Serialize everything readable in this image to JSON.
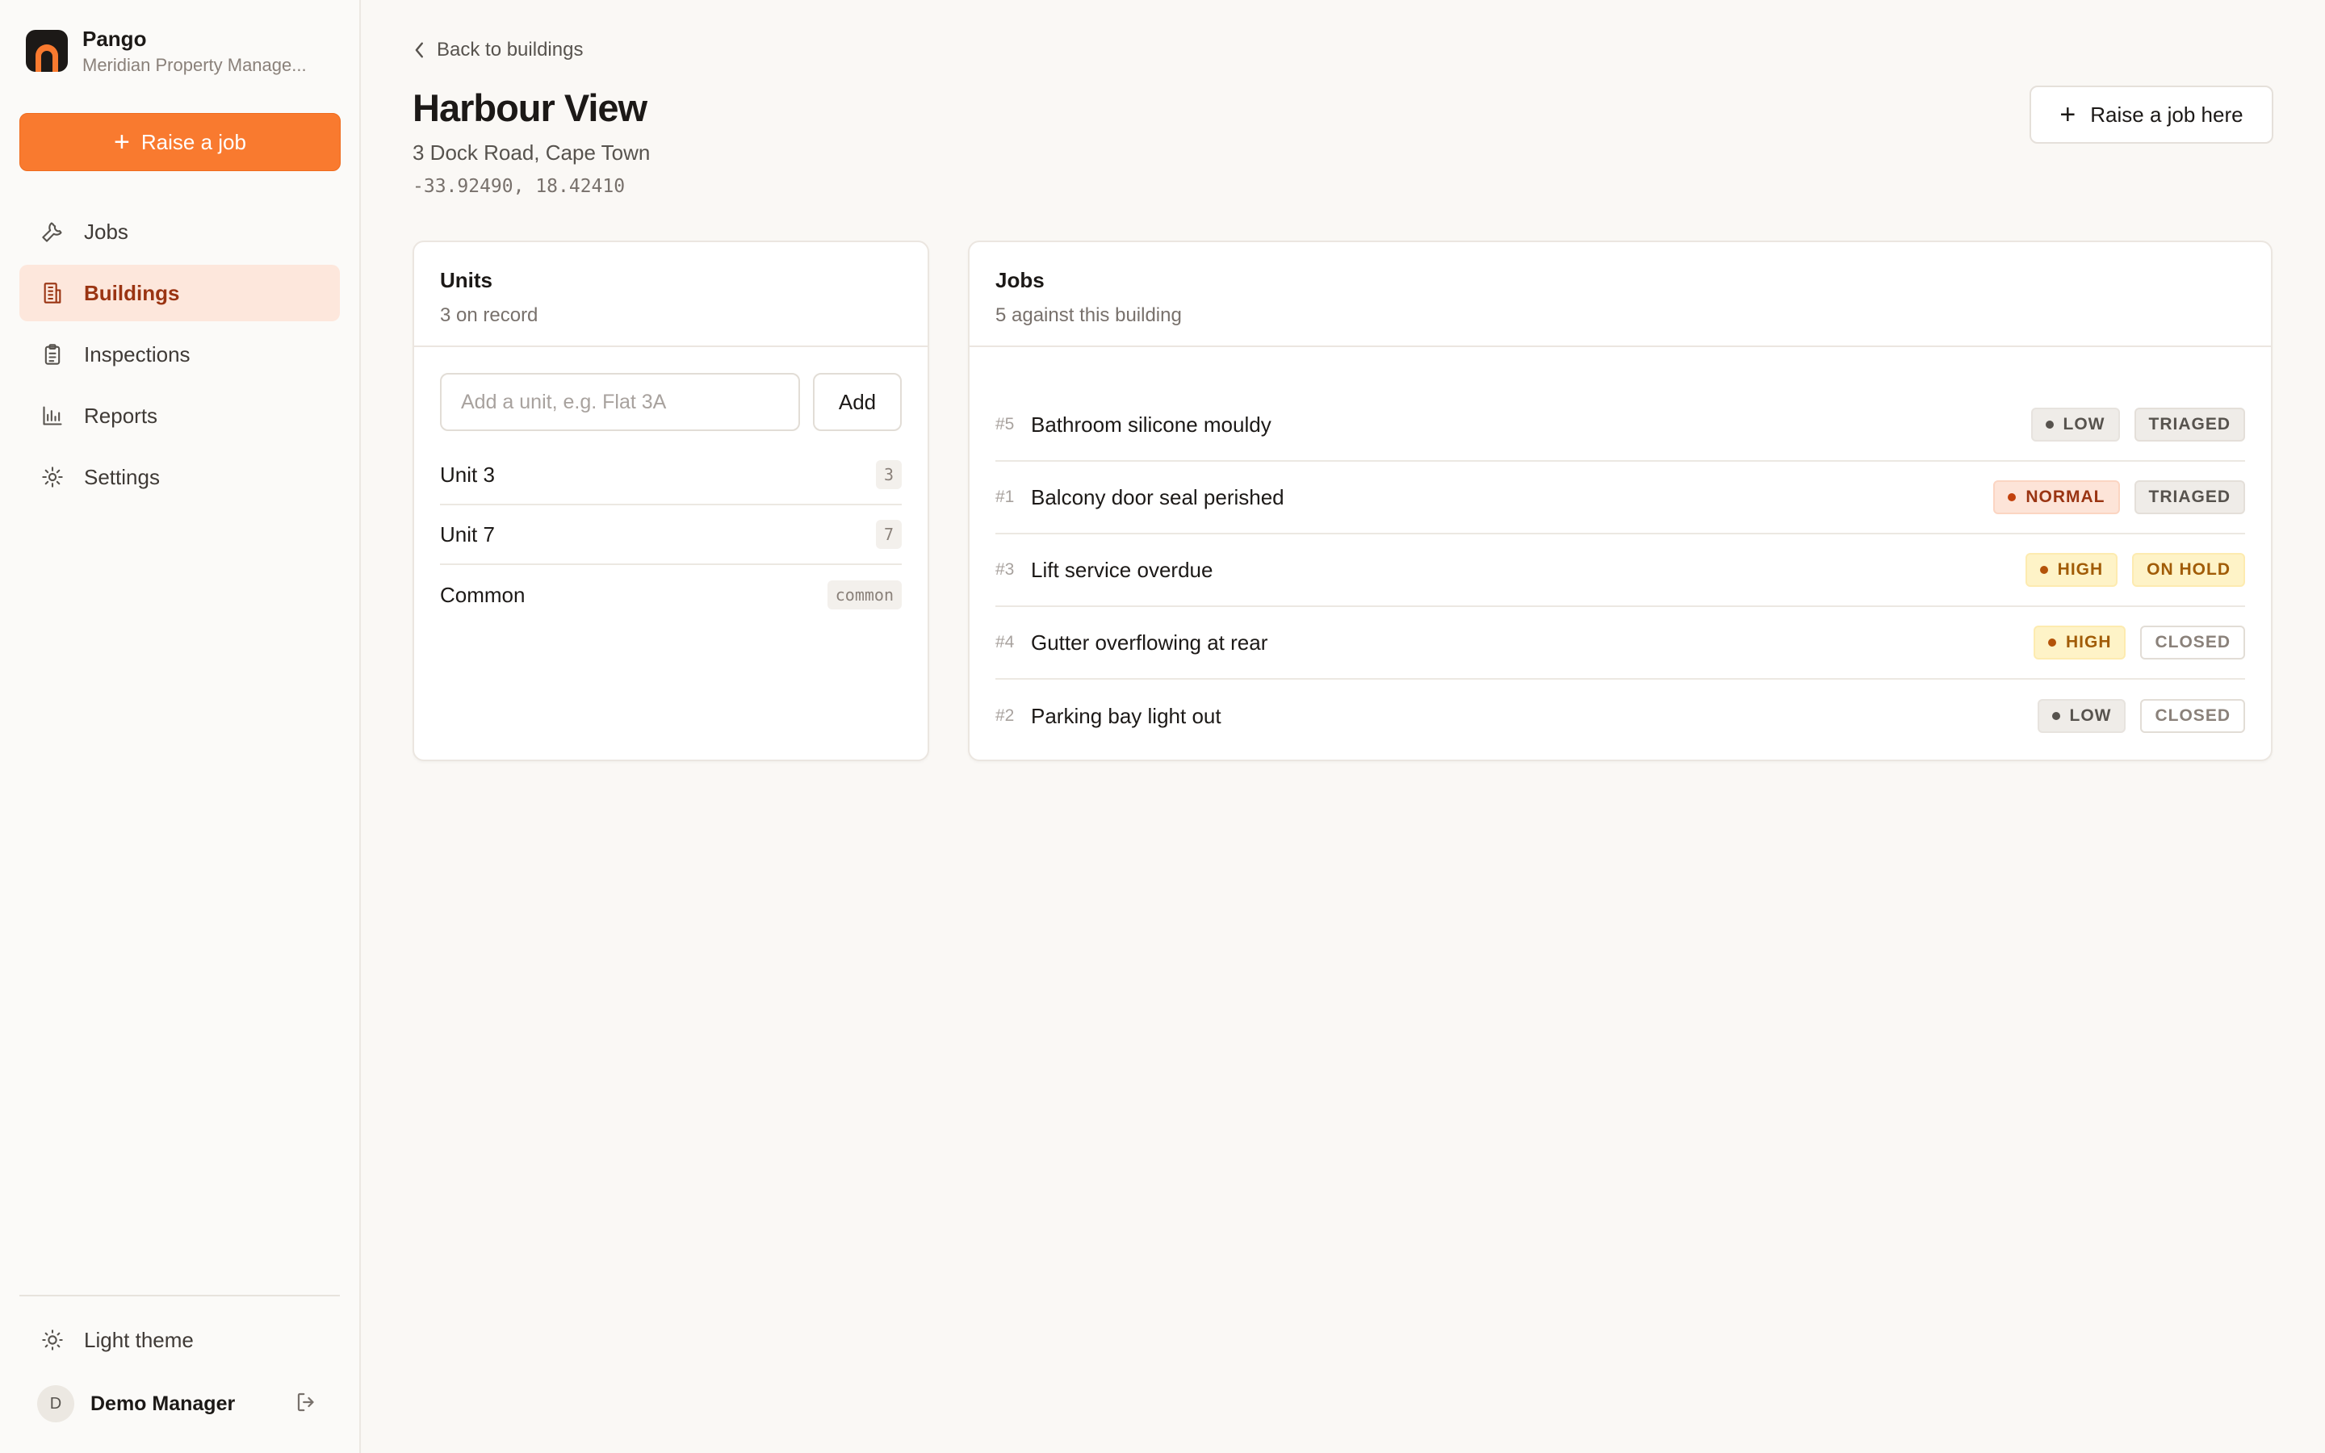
{
  "brand": {
    "name": "Pango",
    "org": "Meridian Property Manage..."
  },
  "sidebar": {
    "raise_label": "Raise a job",
    "items": [
      {
        "label": "Jobs",
        "icon": "wrench-icon"
      },
      {
        "label": "Buildings",
        "icon": "building-icon",
        "active": true
      },
      {
        "label": "Inspections",
        "icon": "clipboard-icon"
      },
      {
        "label": "Reports",
        "icon": "bar-chart-icon"
      },
      {
        "label": "Settings",
        "icon": "gear-icon"
      }
    ],
    "theme_label": "Light theme",
    "user": {
      "initial": "D",
      "name": "Demo Manager"
    }
  },
  "page": {
    "back_label": "Back to buildings",
    "title": "Harbour View",
    "address": "3 Dock Road, Cape Town",
    "coords": "-33.92490, 18.42410",
    "raise_here_label": "Raise a job here"
  },
  "units": {
    "title": "Units",
    "subtitle": "3 on record",
    "input_placeholder": "Add a unit, e.g. Flat 3A",
    "add_label": "Add",
    "rows": [
      {
        "label": "Unit 3",
        "tag": "3"
      },
      {
        "label": "Unit 7",
        "tag": "7"
      },
      {
        "label": "Common",
        "tag": "common"
      }
    ]
  },
  "jobs": {
    "title": "Jobs",
    "subtitle": "5 against this building",
    "rows": [
      {
        "num": "#5",
        "title": "Bathroom silicone mouldy",
        "priority": "LOW",
        "status": "TRIAGED"
      },
      {
        "num": "#1",
        "title": "Balcony door seal perished",
        "priority": "NORMAL",
        "status": "TRIAGED"
      },
      {
        "num": "#3",
        "title": "Lift service overdue",
        "priority": "HIGH",
        "status": "ON HOLD"
      },
      {
        "num": "#4",
        "title": "Gutter overflowing at rear",
        "priority": "HIGH",
        "status": "CLOSED"
      },
      {
        "num": "#2",
        "title": "Parking bay light out",
        "priority": "LOW",
        "status": "CLOSED"
      }
    ]
  },
  "colors": {
    "accent": "#f97a2f",
    "active_bg": "#fde7dc",
    "active_text": "#9a3412"
  }
}
